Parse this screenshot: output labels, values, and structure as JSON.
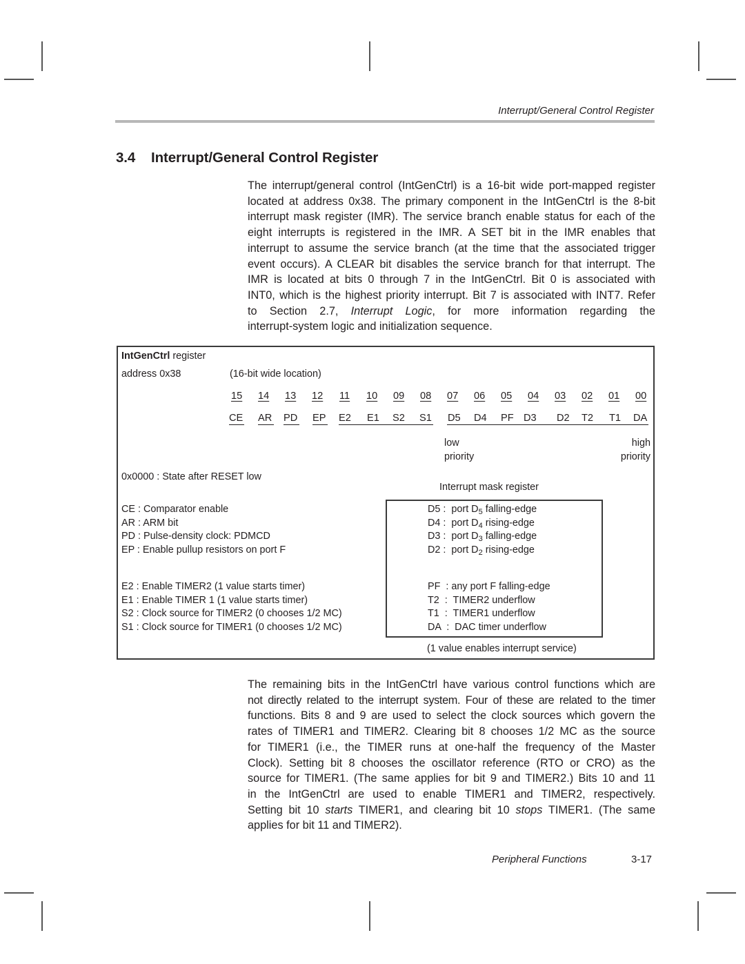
{
  "running_head": "Interrupt/General Control Register",
  "section": {
    "number": "3.4",
    "title": "Interrupt/General Control Register"
  },
  "intro_paragraph": {
    "lines": [
      "The interrupt/general control (IntGenCtrl) is a 16-bit wide port-mapped register",
      "located at address 0x38. The primary component in the IntGenCtrl is the 8-bit",
      "interrupt mask register (IMR). The service branch enable status for each of the",
      "eight interrupts is registered in the IMR. A SET bit in the IMR enables that",
      "interrupt to assume the service branch (at the time that the associated trigger",
      "event occurs). A CLEAR bit disables the service branch for that interrupt. The",
      "IMR is located at bits 0 through 7 in the IntGenCtrl. Bit 0 is associated with",
      "INT0, which is the highest priority interrupt. Bit 7 is associated with INT7. Refer"
    ],
    "line9_prefix": "to Section 2.7, ",
    "line9_italic": "Interrupt Logic",
    "line9_suffix": ", for more information regarding the",
    "line10": "interrupt-system logic and initialization sequence."
  },
  "figure": {
    "register_name": "IntGenCtrl",
    "register_suffix": " register",
    "address_label": "address 0x38",
    "width_note": "(16-bit wide location)",
    "bit_numbers": [
      "15",
      "14",
      "13",
      "12",
      "11",
      "10",
      "09",
      "08",
      "07",
      "06",
      "05",
      "04",
      "03",
      "02",
      "01",
      "00"
    ],
    "bit_names": [
      "CE",
      "AR",
      "PD",
      "EP",
      "E2",
      "E1",
      "S2",
      "S1",
      "D5",
      "D4",
      "PF",
      "D3",
      "D2",
      "T2",
      "T1",
      "DA"
    ],
    "low_priority": [
      "low",
      "priority"
    ],
    "high_priority": [
      "high",
      "priority"
    ],
    "reset_state": "0x0000 : State after RESET low",
    "imr_title": "Interrupt mask register",
    "control_bits_group1": [
      "CE : Comparator enable",
      "AR : ARM bit",
      "PD : Pulse-density clock: PDMCD",
      "EP : Enable pullup resistors on port F"
    ],
    "control_bits_group2": [
      "E2 : Enable TIMER2 (1 value starts timer)",
      "E1 : Enable TIMER 1 (1 value starts timer)",
      "S2 : Clock source for TIMER2 (0 chooses 1/2 MC)",
      "S1 : Clock source for TIMER1 (0 chooses 1/2 MC)"
    ],
    "imr_entries_group1": [
      {
        "code": "D5",
        "sep": " :  ",
        "pre": "port D",
        "sub": "5",
        "post": " falling-edge"
      },
      {
        "code": "D4",
        "sep": " :  ",
        "pre": "port D",
        "sub": "4",
        "post": " rising-edge"
      },
      {
        "code": "D3",
        "sep": " :  ",
        "pre": "port D",
        "sub": "3",
        "post": " falling-edge"
      },
      {
        "code": "D2",
        "sep": " :  ",
        "pre": "port D",
        "sub": "2",
        "post": " rising-edge"
      }
    ],
    "imr_entries_group2": [
      "PF  : any port F falling-edge",
      "T2  :  TIMER2 underflow",
      "T1  :  TIMER1 underflow",
      "DA  :  DAC timer underflow"
    ],
    "imr_note": "(1 value enables interrupt service)"
  },
  "second_paragraph": {
    "lines": [
      "The remaining bits in the IntGenCtrl have various control functions which are",
      "not directly related to the interrupt system. Four of these are related to the timer",
      "functions. Bits 8 and 9 are used to select the clock sources which govern the",
      "rates of TIMER1 and TIMER2. Clearing bit 8 chooses 1/2 MC as the source",
      "for TIMER1 (i.e., the TIMER runs at one-half the frequency of the Master",
      "Clock). Setting bit 8 chooses the oscillator reference (RTO or CRO) as the",
      "source for TIMER1. (The same applies for bit 9 and TIMER2.) Bits 10 and 11",
      "in the IntGenCtrl are used to enable TIMER1 and TIMER2, respectively."
    ],
    "line9_a": "Setting bit 10 ",
    "line9_i1": "starts",
    "line9_b": " TIMER1, and clearing bit 10 ",
    "line9_i2": "stops",
    "line9_c": " TIMER1. (The same",
    "line10": "applies for bit 11 and TIMER2)."
  },
  "footer": {
    "chapter_title": "Peripheral Functions",
    "page_number": "3-17"
  }
}
